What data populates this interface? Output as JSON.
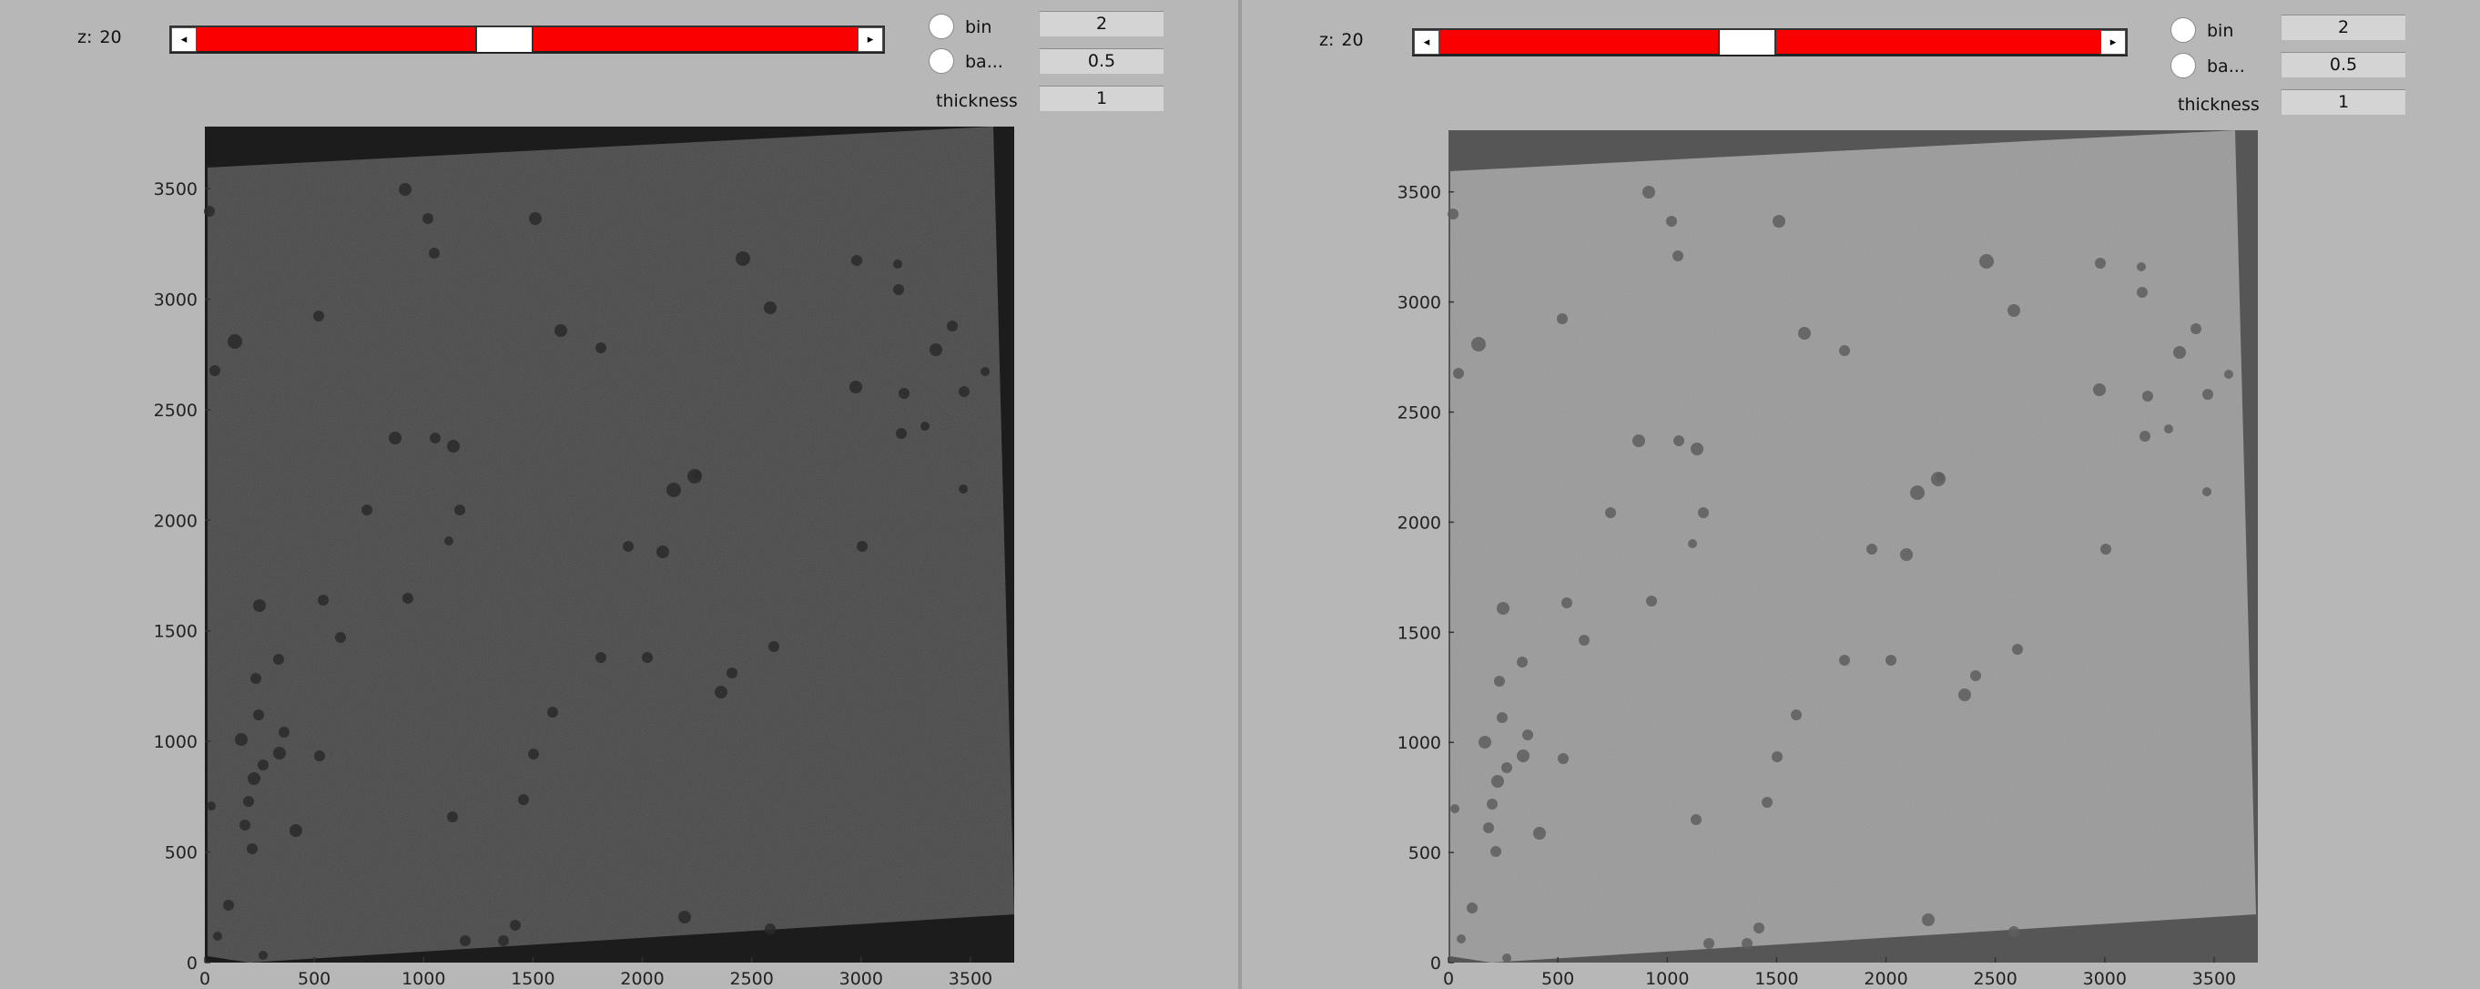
{
  "panels": [
    {
      "z_label": "z:",
      "z_value": "20",
      "slider": {
        "value_fraction": 0.46,
        "left_arrow": "◂",
        "right_arrow": "▸"
      },
      "bin_label": "bin",
      "bin_value": "2",
      "ba_label": "ba...",
      "ba_value": "0.5",
      "thickness_label": "thickness",
      "thickness_value": "1",
      "image": {
        "outer_bg": "#1c1c1c",
        "fill": "#484848",
        "x_ticks": [
          "0",
          "500",
          "1000",
          "1500",
          "2000",
          "2500",
          "3000",
          "3500"
        ],
        "y_ticks": [
          "0",
          "500",
          "1000",
          "1500",
          "2000",
          "2500",
          "3000",
          "3500"
        ]
      }
    },
    {
      "z_label": "z:",
      "z_value": "20",
      "slider": {
        "value_fraction": 0.46,
        "left_arrow": "◂",
        "right_arrow": "▸"
      },
      "bin_label": "bin",
      "bin_value": "2",
      "ba_label": "ba...",
      "ba_value": "0.5",
      "thickness_label": "thickness",
      "thickness_value": "1",
      "image": {
        "outer_bg": "#565656",
        "fill": "#9a9a9a",
        "x_ticks": [
          "0",
          "500",
          "1000",
          "1500",
          "2000",
          "2500",
          "3000",
          "3500"
        ],
        "y_ticks": [
          "0",
          "500",
          "1000",
          "1500",
          "2000",
          "2500",
          "3000",
          "3500"
        ]
      }
    }
  ],
  "colors": {
    "slider_track": "#fb0000",
    "window_bg": "#b7b7b7"
  }
}
